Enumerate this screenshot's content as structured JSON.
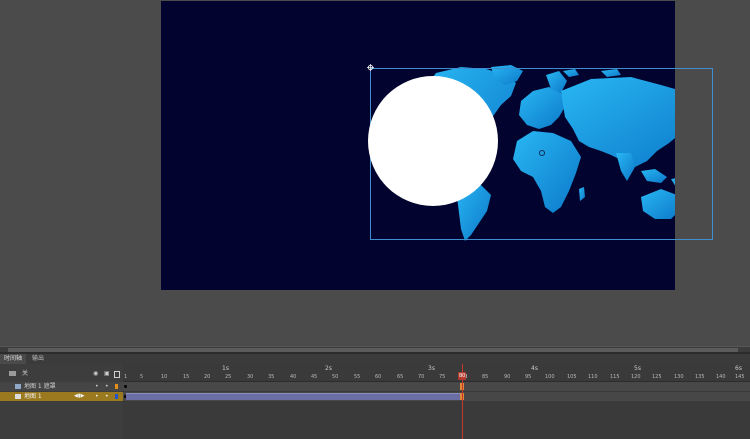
{
  "timeline": {
    "panel_tabs": [
      "时间轴",
      "输出"
    ],
    "layer_header_label": "关",
    "layers": [
      {
        "name": "地图 1 遮罩"
      },
      {
        "name": "地图 1"
      }
    ],
    "seconds_labels": [
      "1s",
      "2s",
      "3s",
      "4s",
      "5s",
      "6s"
    ],
    "frame_numbers": [
      "1",
      "5",
      "10",
      "15",
      "20",
      "25",
      "30",
      "35",
      "40",
      "45",
      "50",
      "55",
      "60",
      "65",
      "70",
      "75",
      "80",
      "85",
      "90",
      "95",
      "100",
      "105",
      "110",
      "115",
      "120",
      "125",
      "130",
      "135",
      "140",
      "145"
    ],
    "current_frame": "80"
  }
}
